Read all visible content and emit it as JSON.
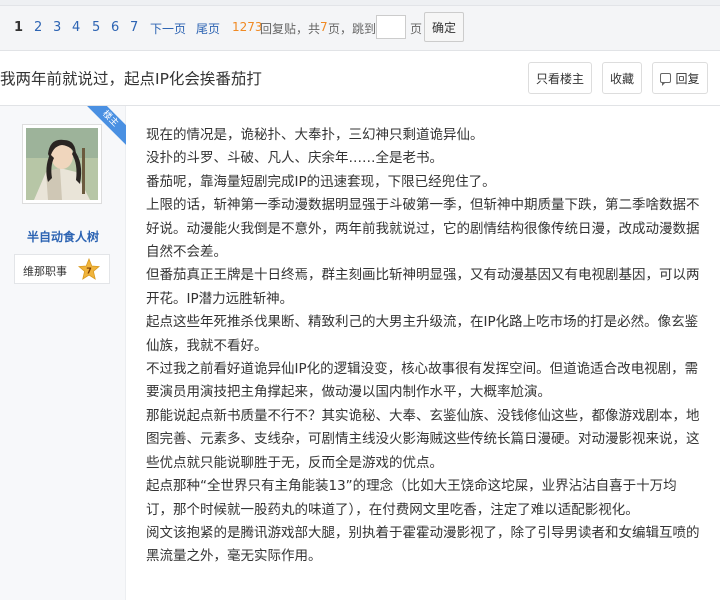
{
  "pager": {
    "current": "1",
    "pages": [
      "2",
      "3",
      "4",
      "5",
      "6",
      "7"
    ],
    "next": "下一页",
    "last": "尾页",
    "reply_count": "1273",
    "reply_text": "回复贴，共",
    "total_pages": "7",
    "pages_suffix": "页，跳到",
    "page_unit": "页",
    "jump_value": "",
    "confirm": "确定"
  },
  "thread": {
    "title": "我两年前就说过，起点IP化会挨番茄打",
    "only_op": "只看楼主",
    "favorite": "收藏",
    "reply": "回复"
  },
  "author": {
    "ribbon": "楼主",
    "name": "半自动食人树",
    "role": "维那职事",
    "level": "7"
  },
  "post": {
    "paragraphs": [
      "现在的情况是，诡秘扑、大奉扑，三幻神只剩道诡异仙。",
      "没扑的斗罗、斗破、凡人、庆余年……全是老书。",
      "番茄呢，靠海量短剧完成IP的迅速套现，下限已经兜住了。",
      "上限的话，斩神第一季动漫数据明显强于斗破第一季，但斩神中期质量下跌，第二季啥数据不好说。动漫能火我倒是不意外，两年前我就说过，它的剧情结构很像传统日漫，改成动漫数据自然不会差。",
      "但番茄真正王牌是十日终焉，群主刻画比斩神明显强，又有动漫基因又有电视剧基因，可以两开花。IP潜力远胜斩神。",
      "起点这些年死推杀伐果断、精致利己的大男主升级流，在IP化路上吃市场的打是必然。像玄鉴仙族，我就不看好。",
      "不过我之前看好道诡异仙IP化的逻辑没变，核心故事很有发挥空间。但道诡适合改电视剧，需要演员用演技把主角撑起来，做动漫以国内制作水平，大概率尬演。",
      "那能说起点新书质量不行不？其实诡秘、大奉、玄鉴仙族、没钱修仙这些，都像游戏剧本，地图完善、元素多、支线杂，可剧情主线没火影海贼这些传统长篇日漫硬。对动漫影视来说，这些优点就只能说聊胜于无，反而全是游戏的优点。",
      "起点那种“全世界只有主角能装13”的理念（比如大王饶命这坨屎，业界沾沾自喜于十万均订，那个时候就一股药丸的味道了），在付费网文里吃香，注定了难以适配影视化。",
      "阅文该抱紧的是腾讯游戏部大腿，别执着于霍霍动漫影视了，除了引导男读者和女编辑互喷的黑流量之外，毫无实际作用。"
    ]
  },
  "colors": {
    "link": "#2d64b3",
    "count": "#f08a24",
    "ribbon": "#4a90e2",
    "badge": "#f0b43c"
  }
}
